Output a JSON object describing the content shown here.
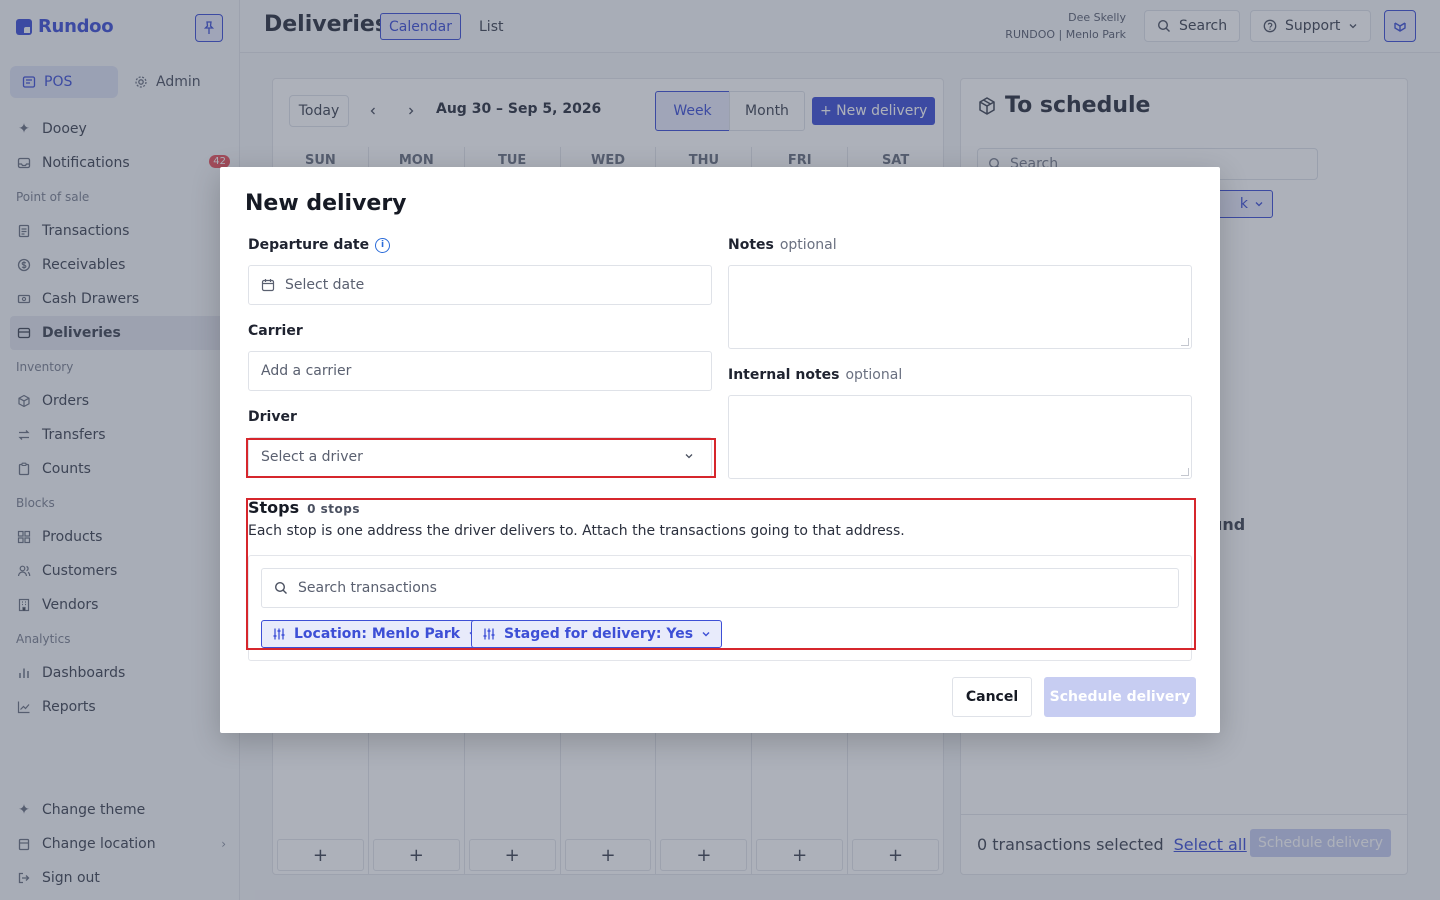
{
  "brand": {
    "name": "Rundoo"
  },
  "sidebar": {
    "modes": [
      {
        "label": "POS",
        "icon": "pos-icon"
      },
      {
        "label": "Admin",
        "icon": "gear-icon"
      }
    ],
    "items": [
      {
        "label": "Dooey",
        "icon": "sparkle-icon"
      },
      {
        "label": "Notifications",
        "icon": "inbox-icon",
        "badge": "42"
      },
      {
        "section": "Point of sale"
      },
      {
        "label": "Transactions",
        "icon": "receipt-icon"
      },
      {
        "label": "Receivables",
        "icon": "dollar-icon"
      },
      {
        "label": "Cash Drawers",
        "icon": "cash-icon"
      },
      {
        "label": "Deliveries",
        "icon": "truck-icon",
        "active": true
      },
      {
        "section": "Inventory"
      },
      {
        "label": "Orders",
        "icon": "box-icon"
      },
      {
        "label": "Transfers",
        "icon": "transfer-icon"
      },
      {
        "label": "Counts",
        "icon": "clipboard-icon"
      },
      {
        "section": "Blocks"
      },
      {
        "label": "Products",
        "icon": "grid-icon"
      },
      {
        "label": "Customers",
        "icon": "users-icon"
      },
      {
        "label": "Vendors",
        "icon": "building-icon"
      },
      {
        "section": "Analytics"
      },
      {
        "label": "Dashboards",
        "icon": "bar-chart-icon"
      },
      {
        "label": "Reports",
        "icon": "line-chart-icon"
      }
    ],
    "bottom": [
      {
        "label": "Change theme",
        "icon": "sparkle-icon"
      },
      {
        "label": "Change location",
        "icon": "store-icon",
        "chevron": true
      },
      {
        "label": "Sign out",
        "icon": "sign-out-icon"
      }
    ]
  },
  "topbar": {
    "title": "Deliveries",
    "tabs": [
      "Calendar",
      "List"
    ],
    "user_name": "Dee Skelly",
    "user_location": "RUNDOO | Menlo Park",
    "search_label": "Search",
    "support_label": "Support"
  },
  "calendar": {
    "today_label": "Today",
    "range": "Aug 30 – Sep 5, 2026",
    "view_week": "Week",
    "view_month": "Month",
    "new_delivery": "+ New delivery",
    "days": [
      "SUN",
      "MON",
      "TUE",
      "WED",
      "THU",
      "FRI",
      "SAT"
    ],
    "add_symbol": "+"
  },
  "schedule_panel": {
    "title": "To schedule",
    "search_placeholder": "Search",
    "filter_fragment": "k",
    "empty_fragment": "und",
    "selected_text": "0 transactions selected",
    "select_all": "Select all",
    "schedule_button": "Schedule delivery"
  },
  "modal": {
    "title": "New delivery",
    "departure_label": "Departure date",
    "departure_placeholder": "Select date",
    "carrier_label": "Carrier",
    "carrier_placeholder": "Add a carrier",
    "driver_label": "Driver",
    "driver_placeholder": "Select a driver",
    "notes_label": "Notes",
    "internal_notes_label": "Internal notes",
    "optional": "optional",
    "stops_label": "Stops",
    "stops_count": "0 stops",
    "stops_description": "Each stop is one address the driver delivers to. Attach the transactions going to that address.",
    "search_transactions_placeholder": "Search transactions",
    "filters": [
      "Location: Menlo Park",
      "Staged for delivery: Yes"
    ],
    "cancel": "Cancel",
    "schedule": "Schedule delivery"
  },
  "colors": {
    "accent": "#3d4fd6",
    "highlight": "#d6262c",
    "disabled_button": "#c7cdf2"
  }
}
